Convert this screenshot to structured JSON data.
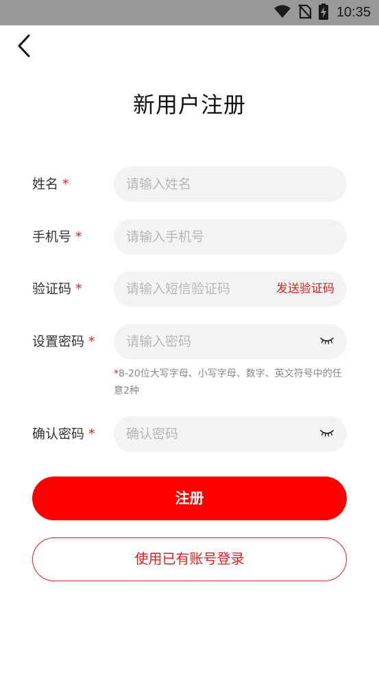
{
  "status_bar": {
    "time": "10:35",
    "icons": [
      "wifi-icon",
      "no-sim-icon",
      "battery-charging-icon"
    ]
  },
  "header": {
    "title": "新用户注册",
    "back_icon": "chevron-left-icon"
  },
  "form": {
    "name": {
      "label": "姓名",
      "required": "*",
      "placeholder": "请输入姓名",
      "value": ""
    },
    "phone": {
      "label": "手机号",
      "required": "*",
      "placeholder": "请输入手机号",
      "value": ""
    },
    "code": {
      "label": "验证码",
      "required": "*",
      "placeholder": "请输入短信验证码",
      "value": "",
      "action_label": "发送验证码"
    },
    "password": {
      "label": "设置密码",
      "required": "*",
      "placeholder": "请输入密码",
      "value": "",
      "eye_icon": "eye-closed-icon"
    },
    "password_hint": {
      "star": "*",
      "text": "8-20位大写字母、小写字母、数字、英文符号中的任意2种"
    },
    "confirm": {
      "label": "确认密码",
      "required": "*",
      "placeholder": "确认密码",
      "value": "",
      "eye_icon": "eye-closed-icon"
    }
  },
  "actions": {
    "register_label": "注册",
    "login_label": "使用已有账号登录"
  },
  "colors": {
    "accent": "#ff0000",
    "accent_text": "#e51b1b",
    "input_bg": "#f3f3f4",
    "status_bar_bg": "#999999"
  }
}
